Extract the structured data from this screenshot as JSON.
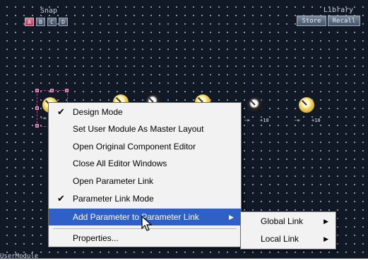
{
  "snap": {
    "label": "Snap",
    "buttons": [
      "A",
      "B",
      "C",
      "D"
    ],
    "active": "A"
  },
  "library": {
    "label": "Library",
    "store": "Store",
    "recall": "Recall"
  },
  "knobs": {
    "scale_min": "-∞",
    "scale_max": "+10",
    "count": 7
  },
  "context_menu": {
    "items": [
      {
        "label": "Design Mode",
        "checked": true
      },
      {
        "label": "Set User Module As Master Layout",
        "checked": false
      },
      {
        "label": "Open Original Component Editor",
        "checked": false
      },
      {
        "label": "Close All Editor Windows",
        "checked": false
      },
      {
        "label": "Open Parameter Link",
        "checked": false
      },
      {
        "label": "Parameter Link Mode",
        "checked": true
      },
      {
        "label": "Add Parameter to Parameter Link",
        "checked": false,
        "submenu": true,
        "highlighted": true
      },
      {
        "label": "Properties...",
        "checked": false
      }
    ]
  },
  "submenu": {
    "items": [
      {
        "label": "Global Link"
      },
      {
        "label": "Local Link"
      }
    ]
  },
  "statusbar": {
    "text": "UserModule"
  },
  "colors": {
    "canvas_bg": "#111826",
    "menu_highlight": "#2f60c8",
    "snap_active": "#c4506e"
  }
}
